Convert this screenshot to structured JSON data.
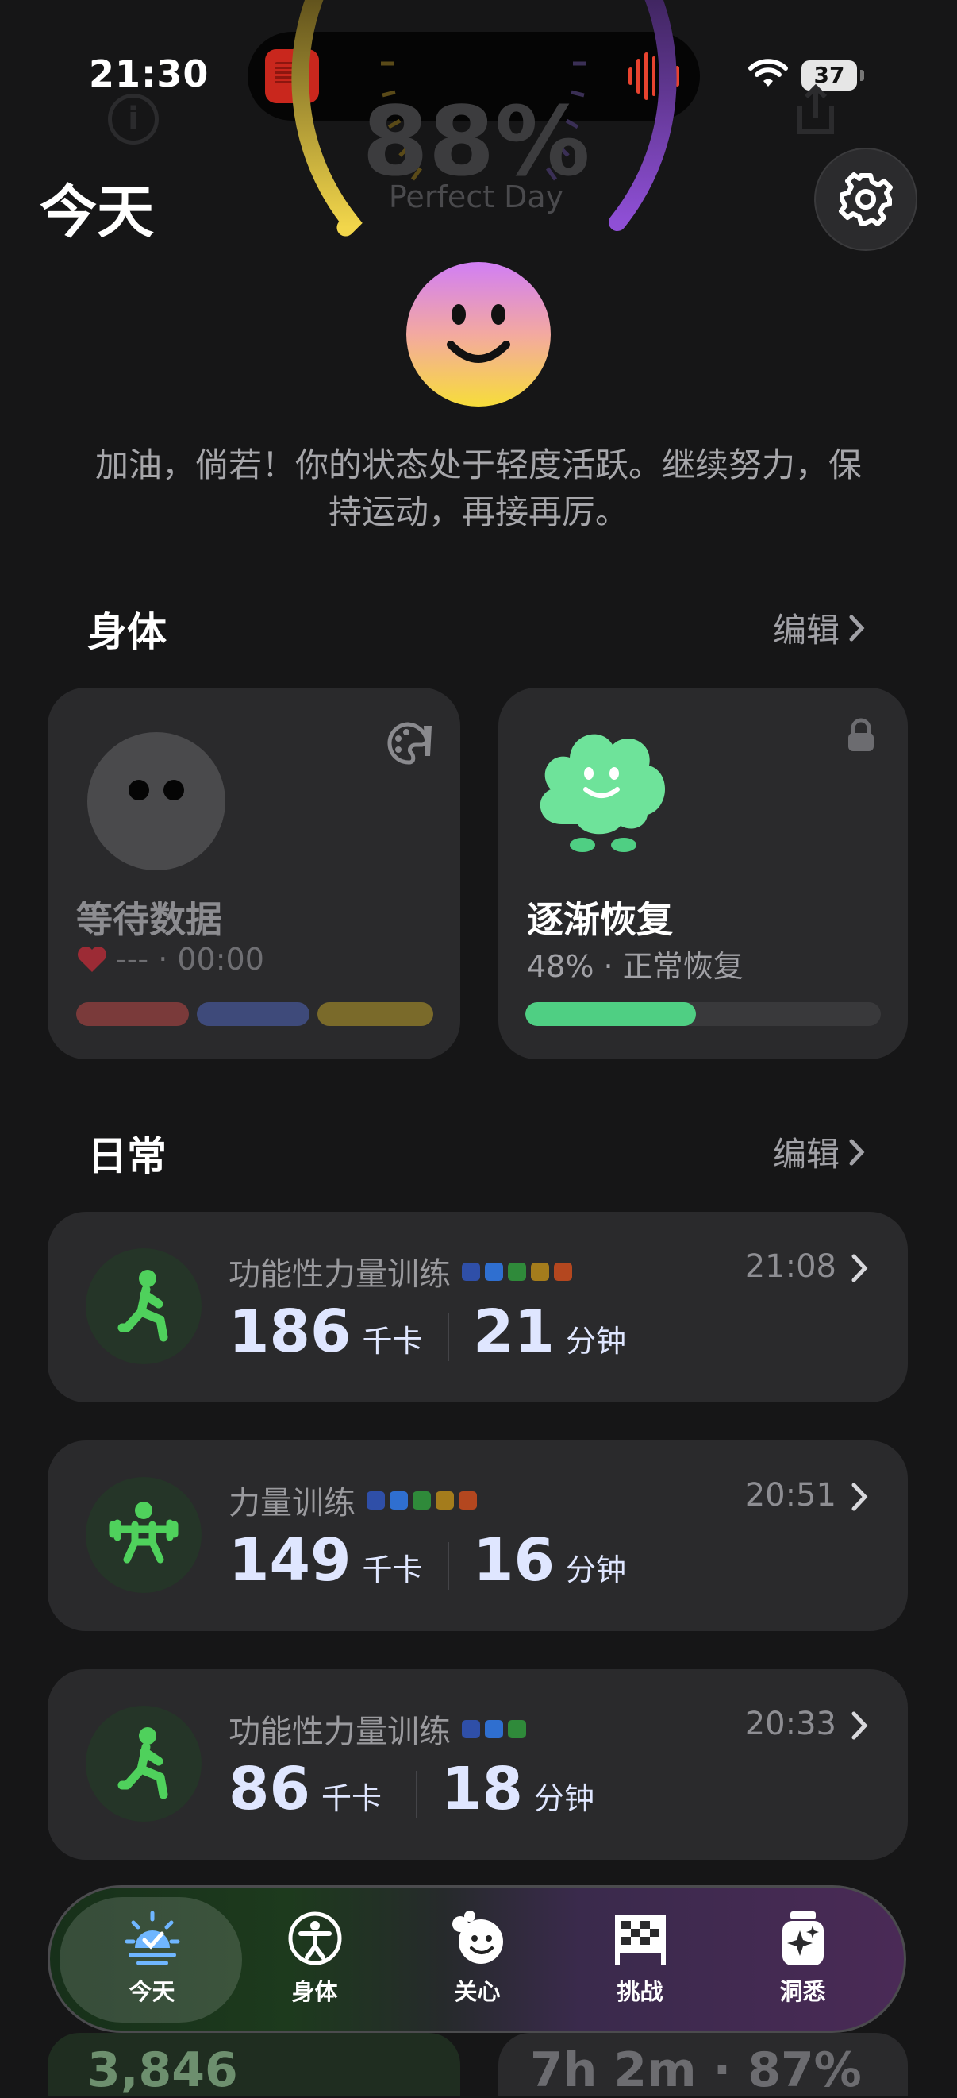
{
  "status_bar": {
    "time": "21:30",
    "battery": "37"
  },
  "hero": {
    "score_text": "88%",
    "score_label": "Perfect Day",
    "page_title": "今天",
    "greeting": "加油，倘若！你的状态处于轻度活跃。继续努力，保持运动，再接再厉。"
  },
  "body_section": {
    "title": "身体",
    "edit_label": "编辑",
    "wait_card": {
      "title": "等待数据",
      "subtitle": "--- · 00:00"
    },
    "recovery_card": {
      "title": "逐渐恢复",
      "subtitle": "48% · 正常恢复",
      "progress": 0.48
    }
  },
  "daily_section": {
    "title": "日常",
    "edit_label": "编辑",
    "workouts": [
      {
        "name": "功能性力量训练",
        "time": "21:08",
        "kcal": "186",
        "kcal_unit": "千卡",
        "minutes": "21",
        "minutes_unit": "分钟",
        "icon": "lunge-icon",
        "dots": [
          "#2f4fa8",
          "#2f6fd0",
          "#2f8a3a",
          "#a47c1c",
          "#b4471f"
        ]
      },
      {
        "name": "力量训练",
        "time": "20:51",
        "kcal": "149",
        "kcal_unit": "千卡",
        "minutes": "16",
        "minutes_unit": "分钟",
        "icon": "weightlifting-icon",
        "dots": [
          "#2f4fa8",
          "#2f6fd0",
          "#2f8a3a",
          "#a47c1c",
          "#b4471f"
        ]
      },
      {
        "name": "功能性力量训练",
        "time": "20:33",
        "kcal": "86",
        "kcal_unit": "千卡",
        "minutes": "18",
        "minutes_unit": "分钟",
        "icon": "lunge-icon",
        "dots": [
          "#2f4fa8",
          "#2f6fd0",
          "#2f8a3a"
        ]
      }
    ]
  },
  "bottom_peek": {
    "left_value": "3,846",
    "right_value": "7h 2m · 87%"
  },
  "tabbar": {
    "tabs": [
      {
        "label": "今天",
        "icon": "sun-check-icon",
        "selected": true
      },
      {
        "label": "身体",
        "icon": "body-icon",
        "selected": false
      },
      {
        "label": "关心",
        "icon": "care-face-icon",
        "selected": false
      },
      {
        "label": "挑战",
        "icon": "checkered-flag-icon",
        "selected": false
      },
      {
        "label": "洞悉",
        "icon": "sparkle-jar-icon",
        "selected": false
      }
    ]
  },
  "colors": {
    "background": "#161617",
    "card": "#2a2a2c",
    "accent_green": "#4fcf83",
    "workout_green": "#4fd15c",
    "gauge_yellow": "#f2d64b",
    "gauge_purple": "#8f4fd6"
  }
}
